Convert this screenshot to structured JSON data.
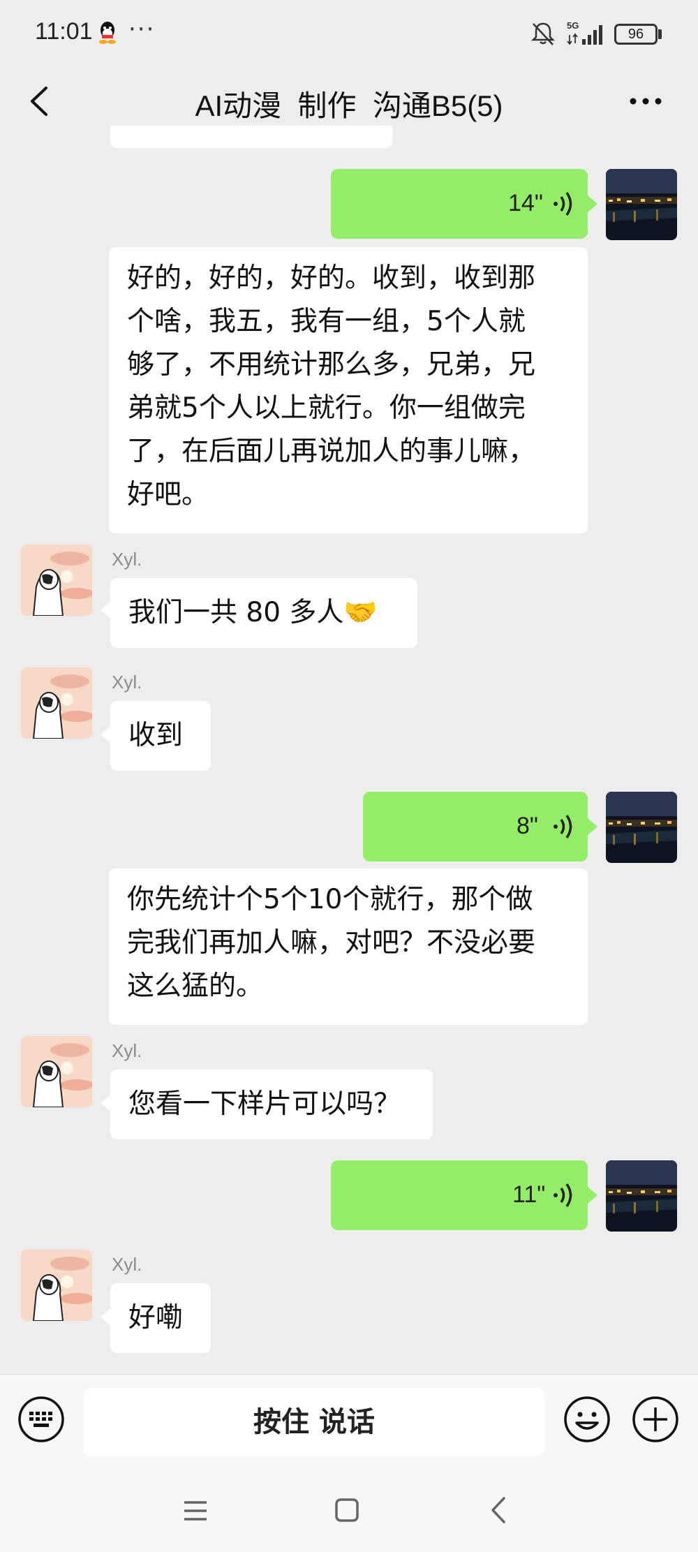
{
  "status_bar": {
    "time": "11:01",
    "more": "···",
    "network": "5G",
    "battery": "96"
  },
  "header": {
    "title": "AI动漫  制作  沟通B5(5)"
  },
  "messages": [
    {
      "type": "voice",
      "side": "right",
      "duration": "14\""
    },
    {
      "type": "text",
      "side": "right",
      "lines": [
        "好的，好的，好的。收到，收到那",
        "个啥，我五，我有一组，5个人就",
        "够了，不用统计那么多，兄弟，兄",
        "弟就5个人以上就行。你一组做完",
        "了，在后面儿再说加人的事儿嘛，",
        "好吧。"
      ]
    },
    {
      "type": "text",
      "side": "left",
      "sender": "Xyl.",
      "text": "我们一共 80 多人🤝"
    },
    {
      "type": "text",
      "side": "left",
      "sender": "Xyl.",
      "text": "收到"
    },
    {
      "type": "voice",
      "side": "right",
      "duration": "8\""
    },
    {
      "type": "text",
      "side": "right",
      "lines": [
        "你先统计个5个10个就行，那个做",
        "完我们再加人嘛，对吧？不没必要",
        "这么猛的。"
      ]
    },
    {
      "type": "text",
      "side": "left",
      "sender": "Xyl.",
      "text": "您看一下样片可以吗？"
    },
    {
      "type": "voice",
      "side": "right",
      "duration": "11\""
    },
    {
      "type": "text",
      "side": "left",
      "sender": "Xyl.",
      "text": "好嘞"
    }
  ],
  "input_bar": {
    "talk_label": "按住 说话"
  },
  "colors": {
    "background": "#ededed",
    "sent_bubble": "#95ec69",
    "received_bubble": "#ffffff"
  },
  "icons": [
    "qq-icon",
    "mute-icon",
    "signal-icon",
    "back-icon",
    "more-icon",
    "voice-wave-icon",
    "keyboard-icon",
    "emoji-icon",
    "plus-icon",
    "nav-menu-icon",
    "nav-home-icon",
    "nav-back-icon"
  ]
}
